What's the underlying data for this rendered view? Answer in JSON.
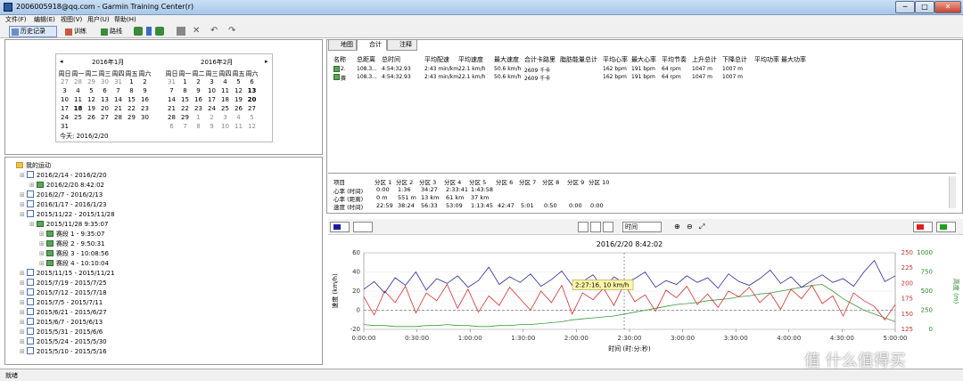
{
  "window": {
    "title": "2006005918@qq.com - Garmin Training Center(r)",
    "btn_min": "─",
    "btn_max": "□",
    "btn_close": "✕"
  },
  "menu": [
    "文件(F)",
    "编辑(E)",
    "视图(V)",
    "用户(U)",
    "帮助(H)"
  ],
  "toolbar": {
    "history": "历史记录",
    "training": "训练",
    "course": "路线"
  },
  "calendar": {
    "month1": "2016年1月",
    "month2": "2016年2月",
    "prev": "◂",
    "next": "▸",
    "weekdays": [
      "周日",
      "周一",
      "周二",
      "周三",
      "周四",
      "周五",
      "周六"
    ],
    "jan": [
      [
        "27",
        "g"
      ],
      [
        "28",
        "g"
      ],
      [
        "29",
        "g"
      ],
      [
        "30",
        "g"
      ],
      [
        "31",
        "g"
      ],
      [
        "1",
        ""
      ],
      [
        "2",
        ""
      ],
      [
        "3",
        ""
      ],
      [
        "4",
        ""
      ],
      [
        "5",
        ""
      ],
      [
        "6",
        ""
      ],
      [
        "7",
        ""
      ],
      [
        "8",
        ""
      ],
      [
        "9",
        ""
      ],
      [
        "10",
        ""
      ],
      [
        "11",
        ""
      ],
      [
        "12",
        ""
      ],
      [
        "13",
        ""
      ],
      [
        "14",
        ""
      ],
      [
        "15",
        ""
      ],
      [
        "16",
        ""
      ],
      [
        "17",
        ""
      ],
      [
        "18",
        "b"
      ],
      [
        "19",
        ""
      ],
      [
        "20",
        ""
      ],
      [
        "21",
        ""
      ],
      [
        "22",
        ""
      ],
      [
        "23",
        ""
      ],
      [
        "24",
        ""
      ],
      [
        "25",
        ""
      ],
      [
        "26",
        ""
      ],
      [
        "27",
        ""
      ],
      [
        "28",
        ""
      ],
      [
        "29",
        ""
      ],
      [
        "30",
        ""
      ],
      [
        "31",
        ""
      ]
    ],
    "feb": [
      [
        "31",
        "g"
      ],
      [
        "1",
        ""
      ],
      [
        "2",
        ""
      ],
      [
        "3",
        ""
      ],
      [
        "4",
        ""
      ],
      [
        "5",
        ""
      ],
      [
        "6",
        ""
      ],
      [
        "7",
        ""
      ],
      [
        "8",
        ""
      ],
      [
        "9",
        ""
      ],
      [
        "10",
        ""
      ],
      [
        "11",
        ""
      ],
      [
        "12",
        ""
      ],
      [
        "13",
        "b"
      ],
      [
        "14",
        ""
      ],
      [
        "15",
        ""
      ],
      [
        "16",
        ""
      ],
      [
        "17",
        ""
      ],
      [
        "18",
        ""
      ],
      [
        "19",
        ""
      ],
      [
        "20",
        "b"
      ],
      [
        "21",
        ""
      ],
      [
        "22",
        ""
      ],
      [
        "23",
        ""
      ],
      [
        "24",
        ""
      ],
      [
        "25",
        ""
      ],
      [
        "26",
        ""
      ],
      [
        "27",
        ""
      ],
      [
        "28",
        ""
      ],
      [
        "29",
        ""
      ],
      [
        "1",
        "g"
      ],
      [
        "2",
        "g"
      ],
      [
        "3",
        "g"
      ],
      [
        "4",
        "g"
      ],
      [
        "5",
        "g"
      ],
      [
        "6",
        "g"
      ],
      [
        "7",
        "g"
      ],
      [
        "8",
        "g"
      ],
      [
        "9",
        "g"
      ],
      [
        "10",
        "g"
      ],
      [
        "11",
        "g"
      ],
      [
        "12",
        "g"
      ]
    ],
    "today": "今天: 2016/2/20"
  },
  "tree": {
    "root": "我的运动",
    "nodes": [
      {
        "label": "2016/2/14 - 2016/2/20",
        "level": 1,
        "icon": "cal"
      },
      {
        "label": "2016/2/20 8:42:02",
        "level": 2,
        "icon": "run"
      },
      {
        "label": "2016/2/7 - 2016/2/13",
        "level": 1,
        "icon": "cal"
      },
      {
        "label": "2016/1/17 - 2016/1/23",
        "level": 1,
        "icon": "cal"
      },
      {
        "label": "2015/11/22 - 2015/11/28",
        "level": 1,
        "icon": "cal"
      },
      {
        "label": "2015/11/28 9:35:07",
        "level": 2,
        "icon": "run"
      },
      {
        "label": "赛段 1 - 9:35:07",
        "level": 3,
        "icon": "run"
      },
      {
        "label": "赛段 2 - 9:50:31",
        "level": 3,
        "icon": "run"
      },
      {
        "label": "赛段 3 - 10:08:56",
        "level": 3,
        "icon": "run"
      },
      {
        "label": "赛段 4 - 10:10:04",
        "level": 3,
        "icon": "run"
      },
      {
        "label": "2015/11/15 - 2015/11/21",
        "level": 1,
        "icon": "cal"
      },
      {
        "label": "2015/7/19 - 2015/7/25",
        "level": 1,
        "icon": "cal"
      },
      {
        "label": "2015/7/12 - 2015/7/18",
        "level": 1,
        "icon": "cal"
      },
      {
        "label": "2015/7/5 - 2015/7/11",
        "level": 1,
        "icon": "cal"
      },
      {
        "label": "2015/6/21 - 2015/6/27",
        "level": 1,
        "icon": "cal"
      },
      {
        "label": "2015/6/7 - 2015/6/13",
        "level": 1,
        "icon": "cal"
      },
      {
        "label": "2015/5/31 - 2015/6/6",
        "level": 1,
        "icon": "cal"
      },
      {
        "label": "2015/5/24 - 2015/5/30",
        "level": 1,
        "icon": "cal"
      },
      {
        "label": "2015/5/10 - 2015/5/16",
        "level": 1,
        "icon": "cal"
      }
    ]
  },
  "tabs": [
    "地图",
    "合计",
    "注释"
  ],
  "summary": {
    "headers": [
      "名称",
      "总距离",
      "总时间",
      "平均配速",
      "平均速度",
      "最大速度",
      "合计卡路里",
      "脂肪能量总计",
      "平均心率",
      "最大心率",
      "平均节奏",
      "上升总计",
      "下降总计",
      "平均功率",
      "最大功率"
    ],
    "rows": [
      [
        "2.",
        "108.3...",
        "4:54:32.93",
        "2:43 min/km",
        "22.1 km/h",
        "50.6 km/h",
        "2609 千卡",
        "",
        "162 bpm",
        "191 bpm",
        "64 rpm",
        "1047 m",
        "1007 m",
        "",
        ""
      ],
      [
        "赛",
        "108.3...",
        "4:54:32.93",
        "2:43 min/km",
        "22.1 km/h",
        "50.6 km/h",
        "2609 千卡",
        "",
        "162 bpm",
        "191 bpm",
        "64 rpm",
        "1047 m",
        "1007 m",
        "",
        ""
      ]
    ]
  },
  "zones": {
    "headers": [
      "项目",
      "分区 1",
      "分区 2",
      "分区 3",
      "分区 4",
      "分区 5",
      "分区 6",
      "分区 7",
      "分区 8",
      "分区 9",
      "分区 10"
    ],
    "rows": [
      [
        "心率 (时间)",
        "0:00",
        "1:36",
        "34:27",
        "2:33:41",
        "1:43:58",
        "",
        "",
        "",
        "",
        ""
      ],
      [
        "心率 (距离)",
        "0 m",
        "551 m",
        "13 km",
        "61 km",
        "37 km",
        "",
        "",
        "",
        "",
        ""
      ],
      [
        "速度 (时间)",
        "22:59",
        "38:24",
        "56:33",
        "53:09",
        "1:13:45",
        "42:47",
        "5:01",
        "0:50",
        "0:00",
        "0:00"
      ]
    ]
  },
  "chart_controls": {
    "xaxis_select": "时间",
    "left_color": "#1a1aa0",
    "right_color1": "#e02020",
    "right_color2": "#20a020"
  },
  "chart_data": {
    "type": "line",
    "title": "2016/2/20 8:42:02",
    "xlabel": "时间 (时:分:秒)",
    "ylabel_left": "速度 (km/h)",
    "ylabel_right": "高度 (m)",
    "x_ticks": [
      "0:00:00",
      "0:30:00",
      "1:00:00",
      "1:30:00",
      "2:00:00",
      "2:30:00",
      "3:00:00",
      "3:30:00",
      "4:00:00",
      "4:30:00",
      "5:00:00"
    ],
    "y_left_ticks": [
      "60",
      "40",
      "20",
      "0",
      "-20"
    ],
    "y_red_ticks": [
      "250",
      "225",
      "200",
      "175",
      "150",
      "125"
    ],
    "y_green_ticks": [
      "1000",
      "750",
      "500",
      "250",
      "0"
    ],
    "tooltip": "2:27:16, 10 km/h",
    "series": [
      {
        "color": "#2a2a9a",
        "values": [
          22,
          30,
          18,
          34,
          26,
          40,
          21,
          33,
          28,
          36,
          24,
          31,
          45,
          27,
          35,
          29,
          38,
          25,
          32,
          41,
          26,
          30,
          37,
          22,
          35,
          28,
          33,
          40,
          24,
          31,
          27,
          36,
          29,
          34,
          23,
          38,
          30,
          26,
          33,
          42,
          28,
          35,
          24,
          31,
          37,
          29,
          33,
          25,
          40,
          52,
          30,
          36
        ]
      },
      {
        "color": "#d43030",
        "values": [
          14,
          -5,
          20,
          8,
          25,
          -3,
          18,
          10,
          27,
          2,
          22,
          -2,
          15,
          5,
          24,
          12,
          0,
          20,
          8,
          26,
          -4,
          18,
          11,
          23,
          5,
          28,
          9,
          16,
          -1,
          21,
          13,
          25,
          6,
          17,
          3,
          20,
          14,
          24,
          8,
          18,
          1,
          22,
          12,
          26,
          7,
          15,
          -6,
          18,
          10,
          4,
          -10,
          6
        ]
      },
      {
        "color": "#3a9a3a",
        "values": [
          -15,
          -16,
          -16,
          -17,
          -17,
          -17,
          -16,
          -16,
          -15,
          -16,
          -16,
          -17,
          -17,
          -16,
          -16,
          -15,
          -15,
          -14,
          -13,
          -12,
          -10,
          -9,
          -8,
          -7,
          -6,
          -4,
          -2,
          0,
          2,
          4,
          6,
          7,
          8,
          10,
          11,
          12,
          14,
          15,
          17,
          18,
          20,
          22,
          24,
          26,
          27,
          20,
          12,
          6,
          0,
          -4,
          -8,
          -12
        ]
      }
    ]
  },
  "status": "就绪",
  "watermark": "值 什么值得买"
}
